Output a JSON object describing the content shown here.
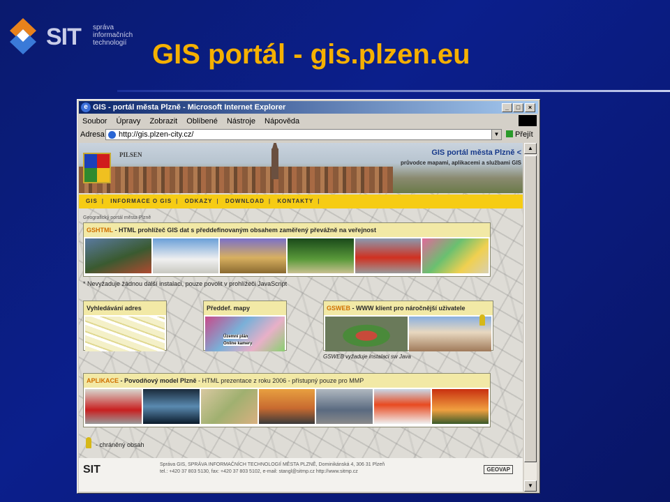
{
  "slide": {
    "title": "GIS portál -  gis.plzen.eu",
    "logo": {
      "name": "SIT",
      "line1": "správa",
      "line2": "informačních",
      "line3": "technologií"
    }
  },
  "browser": {
    "window_title": "GIS - portál města Plzně - Microsoft Internet Explorer",
    "menu": [
      "Soubor",
      "Úpravy",
      "Zobrazit",
      "Oblíbené",
      "Nástroje",
      "Nápověda"
    ],
    "address_label": "Adresa",
    "address_value": "http://gis.plzen-city.cz/",
    "go_label": "Přejít"
  },
  "page": {
    "banner_title": "GIS portál města Plzně <",
    "banner_subtitle": "průvodce mapami, aplikacemi a službami GIS",
    "city_label": "PILSEN",
    "nav": [
      "GIS",
      "INFORMACE O GIS",
      "ODKAZY",
      "DOWNLOAD",
      "KONTAKTY"
    ],
    "breadcrumb": "Geografický portál města Plzně",
    "gshtml": {
      "name": "GSHTML",
      "desc": " - HTML prohlížeč GIS dat s předdefinovaným obsahem zaměřený převážně na veřejnost"
    },
    "gshtml_note": "* Nevyžaduje žádnou další instalaci, pouze povolit v prohlížeči JavaScript",
    "addr_search": "Vyhledávání adres",
    "predef_maps": "Předdef. mapy",
    "predef_items": [
      "Územní plán",
      "Online kamery"
    ],
    "gsweb": {
      "name": "GSWEB",
      "desc": " - WWW klient pro náročnější uživatele"
    },
    "gsweb_note": "GSWEB vyžaduje instalaci sw Java",
    "aplikace": {
      "name": "APLIKACE",
      "link": " - Povodňový model Plzně",
      "desc": " - HTML prezentace z roku 2006 - přístupný pouze pro MMP"
    },
    "legend": "- chráněný obsah",
    "footer": {
      "logo": "SIT",
      "line1": "Správa GIS, SPRÁVA INFORMAČNÍCH TECHNOLOGIÍ MĚSTA PLZNĚ, Dominikánská 4, 306 31 Plzeň",
      "line2": "tel.: +420 37 803 5130, fax: +420 37 803 5102, e-mail: stangl@sitmp.cz  http://www.sitmp.cz",
      "partner": "GEOVAP"
    }
  },
  "colors": {
    "slide_bg": "#0b1f8c",
    "title": "#f5b000",
    "nav_bar": "#f6cc14",
    "panel_head": "#f2e9a6"
  }
}
